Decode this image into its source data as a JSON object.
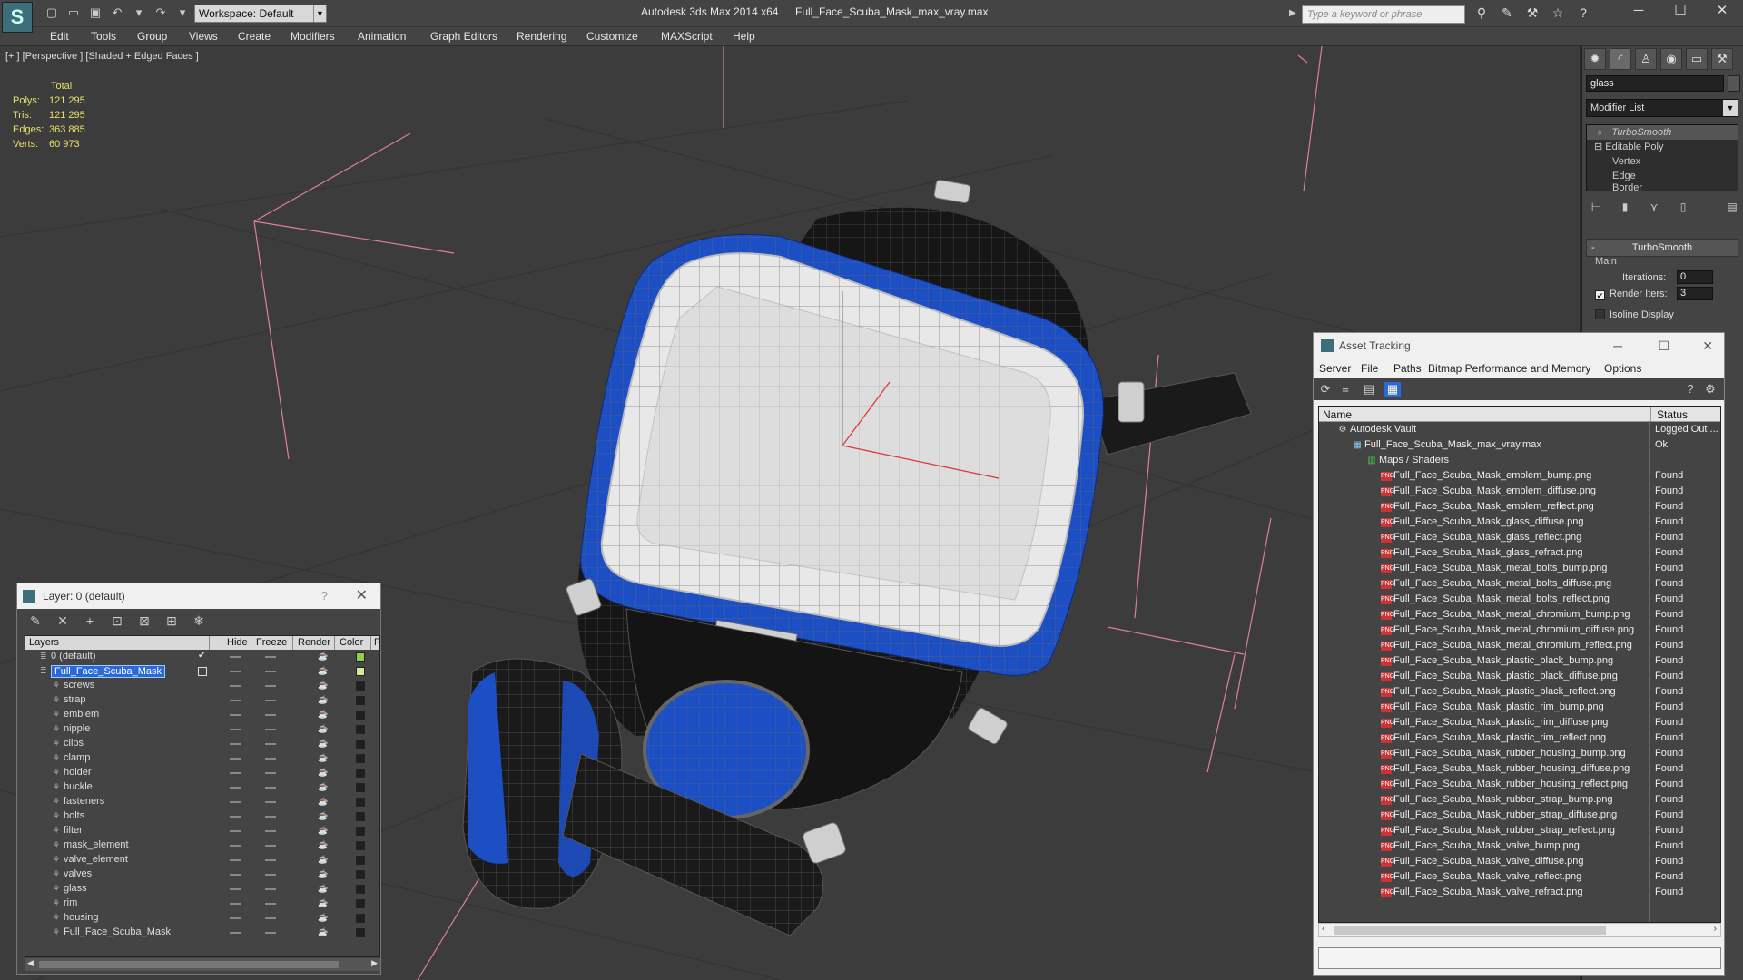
{
  "titlebar": {
    "app_name": "Autodesk 3ds Max  2014 x64",
    "file_name": "Full_Face_Scuba_Mask_max_vray.max",
    "workspace": "Workspace: Default",
    "search_placeholder": "Type a keyword or phrase"
  },
  "menu": [
    "Edit",
    "Tools",
    "Group",
    "Views",
    "Create",
    "Modifiers",
    "Animation",
    "Graph Editors",
    "Rendering",
    "Customize",
    "MAXScript",
    "Help"
  ],
  "viewport": {
    "label": "[+ ] [Perspective ] [Shaded + Edged Faces ]",
    "stats_header": "Total",
    "stats": [
      {
        "k": "Polys:",
        "v": "121 295"
      },
      {
        "k": "Tris:",
        "v": "121 295"
      },
      {
        "k": "Edges:",
        "v": "363 885"
      },
      {
        "k": "Verts:",
        "v": "60 973"
      }
    ],
    "colors": {
      "mesh_blue": "#1d4fc4",
      "mesh_white": "#f0f0f0",
      "mesh_black": "#111111",
      "wire": "#9a9a9a",
      "helper_pink": "#e07f9a"
    }
  },
  "command_panel": {
    "object_name": "glass",
    "modifier_list": "Modifier List",
    "stack": [
      "TurboSmooth",
      "Editable Poly",
      "Vertex",
      "Edge",
      "Border"
    ],
    "rollout_title": "TurboSmooth",
    "group_label": "Main",
    "iterations_label": "Iterations:",
    "iterations_value": "0",
    "render_iters_label": "Render Iters:",
    "render_iters_value": "3",
    "isoline_label": "Isoline Display"
  },
  "layer_window": {
    "title": "Layer: 0 (default)",
    "help": "?",
    "columns": [
      "Layers",
      "Hide",
      "Freeze",
      "Render",
      "Color",
      "R"
    ],
    "rows": [
      {
        "name": "0 (default)",
        "level": 0,
        "color": "#8fd04a",
        "check": "✔"
      },
      {
        "name": "Full_Face_Scuba_Mask",
        "level": 0,
        "color": "#d6e89a",
        "selected": true
      },
      {
        "name": "screws",
        "level": 1,
        "color": "#1f1f1f"
      },
      {
        "name": "strap",
        "level": 1,
        "color": "#1f1f1f"
      },
      {
        "name": "emblem",
        "level": 1,
        "color": "#1f1f1f"
      },
      {
        "name": "nipple",
        "level": 1,
        "color": "#1f1f1f"
      },
      {
        "name": "clips",
        "level": 1,
        "color": "#1f1f1f"
      },
      {
        "name": "clamp",
        "level": 1,
        "color": "#1f1f1f"
      },
      {
        "name": "holder",
        "level": 1,
        "color": "#1f1f1f"
      },
      {
        "name": "buckle",
        "level": 1,
        "color": "#1f1f1f"
      },
      {
        "name": "fasteners",
        "level": 1,
        "color": "#1f1f1f"
      },
      {
        "name": "bolts",
        "level": 1,
        "color": "#1f1f1f"
      },
      {
        "name": "filter",
        "level": 1,
        "color": "#1f1f1f"
      },
      {
        "name": "mask_element",
        "level": 1,
        "color": "#1f1f1f"
      },
      {
        "name": "valve_element",
        "level": 1,
        "color": "#1f1f1f"
      },
      {
        "name": "valves",
        "level": 1,
        "color": "#1f1f1f"
      },
      {
        "name": "glass",
        "level": 1,
        "color": "#1f1f1f"
      },
      {
        "name": "rim",
        "level": 1,
        "color": "#1f1f1f"
      },
      {
        "name": "housing",
        "level": 1,
        "color": "#1f1f1f"
      },
      {
        "name": "Full_Face_Scuba_Mask",
        "level": 1,
        "color": "#1f1f1f"
      }
    ]
  },
  "asset_window": {
    "title": "Asset Tracking",
    "menu": [
      "Server",
      "File",
      "Paths",
      "Bitmap Performance and Memory",
      "Options"
    ],
    "columns": [
      "Name",
      "Status"
    ],
    "rows": [
      {
        "name": "Autodesk Vault",
        "status": "Logged Out ...",
        "level": 0,
        "icon": "vault"
      },
      {
        "name": "Full_Face_Scuba_Mask_max_vray.max",
        "status": "Ok",
        "level": 1,
        "icon": "max"
      },
      {
        "name": "Maps / Shaders",
        "status": "",
        "level": 2,
        "icon": "maps"
      },
      {
        "name": "Full_Face_Scuba_Mask_emblem_bump.png",
        "status": "Found",
        "level": 3,
        "icon": "png"
      },
      {
        "name": "Full_Face_Scuba_Mask_emblem_diffuse.png",
        "status": "Found",
        "level": 3,
        "icon": "png"
      },
      {
        "name": "Full_Face_Scuba_Mask_emblem_reflect.png",
        "status": "Found",
        "level": 3,
        "icon": "png"
      },
      {
        "name": "Full_Face_Scuba_Mask_glass_diffuse.png",
        "status": "Found",
        "level": 3,
        "icon": "png"
      },
      {
        "name": "Full_Face_Scuba_Mask_glass_reflect.png",
        "status": "Found",
        "level": 3,
        "icon": "png"
      },
      {
        "name": "Full_Face_Scuba_Mask_glass_refract.png",
        "status": "Found",
        "level": 3,
        "icon": "png"
      },
      {
        "name": "Full_Face_Scuba_Mask_metal_bolts_bump.png",
        "status": "Found",
        "level": 3,
        "icon": "png"
      },
      {
        "name": "Full_Face_Scuba_Mask_metal_bolts_diffuse.png",
        "status": "Found",
        "level": 3,
        "icon": "png"
      },
      {
        "name": "Full_Face_Scuba_Mask_metal_bolts_reflect.png",
        "status": "Found",
        "level": 3,
        "icon": "png"
      },
      {
        "name": "Full_Face_Scuba_Mask_metal_chromium_bump.png",
        "status": "Found",
        "level": 3,
        "icon": "png"
      },
      {
        "name": "Full_Face_Scuba_Mask_metal_chromium_diffuse.png",
        "status": "Found",
        "level": 3,
        "icon": "png"
      },
      {
        "name": "Full_Face_Scuba_Mask_metal_chromium_reflect.png",
        "status": "Found",
        "level": 3,
        "icon": "png"
      },
      {
        "name": "Full_Face_Scuba_Mask_plastic_black_bump.png",
        "status": "Found",
        "level": 3,
        "icon": "png"
      },
      {
        "name": "Full_Face_Scuba_Mask_plastic_black_diffuse.png",
        "status": "Found",
        "level": 3,
        "icon": "png"
      },
      {
        "name": "Full_Face_Scuba_Mask_plastic_black_reflect.png",
        "status": "Found",
        "level": 3,
        "icon": "png"
      },
      {
        "name": "Full_Face_Scuba_Mask_plastic_rim_bump.png",
        "status": "Found",
        "level": 3,
        "icon": "png"
      },
      {
        "name": "Full_Face_Scuba_Mask_plastic_rim_diffuse.png",
        "status": "Found",
        "level": 3,
        "icon": "png"
      },
      {
        "name": "Full_Face_Scuba_Mask_plastic_rim_reflect.png",
        "status": "Found",
        "level": 3,
        "icon": "png"
      },
      {
        "name": "Full_Face_Scuba_Mask_rubber_housing_bump.png",
        "status": "Found",
        "level": 3,
        "icon": "png"
      },
      {
        "name": "Full_Face_Scuba_Mask_rubber_housing_diffuse.png",
        "status": "Found",
        "level": 3,
        "icon": "png"
      },
      {
        "name": "Full_Face_Scuba_Mask_rubber_housing_reflect.png",
        "status": "Found",
        "level": 3,
        "icon": "png"
      },
      {
        "name": "Full_Face_Scuba_Mask_rubber_strap_bump.png",
        "status": "Found",
        "level": 3,
        "icon": "png"
      },
      {
        "name": "Full_Face_Scuba_Mask_rubber_strap_diffuse.png",
        "status": "Found",
        "level": 3,
        "icon": "png"
      },
      {
        "name": "Full_Face_Scuba_Mask_rubber_strap_reflect.png",
        "status": "Found",
        "level": 3,
        "icon": "png"
      },
      {
        "name": "Full_Face_Scuba_Mask_valve_bump.png",
        "status": "Found",
        "level": 3,
        "icon": "png"
      },
      {
        "name": "Full_Face_Scuba_Mask_valve_diffuse.png",
        "status": "Found",
        "level": 3,
        "icon": "png"
      },
      {
        "name": "Full_Face_Scuba_Mask_valve_reflect.png",
        "status": "Found",
        "level": 3,
        "icon": "png"
      },
      {
        "name": "Full_Face_Scuba_Mask_valve_refract.png",
        "status": "Found",
        "level": 3,
        "icon": "png"
      }
    ]
  }
}
